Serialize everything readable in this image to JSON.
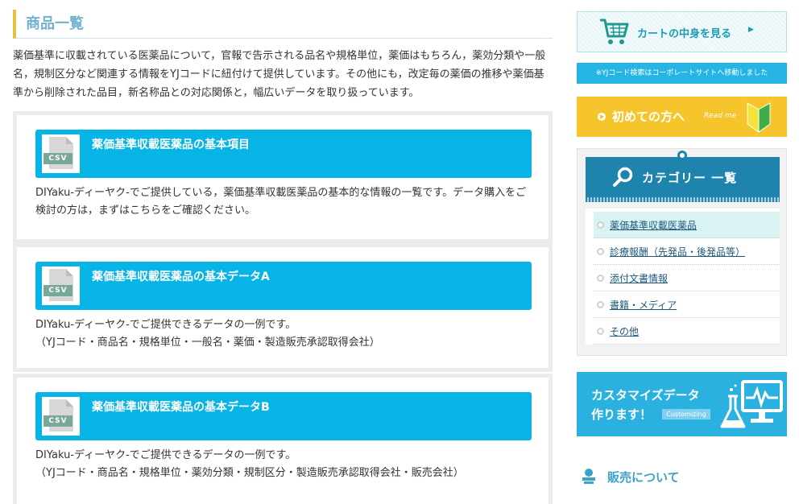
{
  "main": {
    "title": "商品一覧",
    "intro": "薬価基準に収載されている医薬品について，官報で告示される品名や規格単位，薬価はもちろん，薬効分類や一般名，規制区分など関連する情報をYJコードに紐付けて提供しています。その他にも，改定毎の薬価の推移や薬価基準から削除された品目，新名称品との対応関係と，幅広いデータを取り扱っています。",
    "products": [
      {
        "icon_label": "CSV",
        "title": "薬価基準収載医薬品の基本項目",
        "desc": [
          "DIYaku-ディーヤク-でご提供している，薬価基準収載医薬品の基本的な情報の一覧です。データ購入をご検討の方は，まずはこちらをご確認ください。"
        ]
      },
      {
        "icon_label": "CSV",
        "title": "薬価基準収載医薬品の基本データA",
        "desc": [
          "DIYaku-ディーヤク-でご提供できるデータの一例です。",
          "（YJコード・商品名・規格単位・一般名・薬価・製造販売承認取得会社）"
        ]
      },
      {
        "icon_label": "CSV",
        "title": "薬価基準収載医薬品の基本データB",
        "desc": [
          "DIYaku-ディーヤク-でご提供できるデータの一例です。",
          "（YJコード・商品名・規格単位・薬効分類・規制区分・製造販売承認取得会社・販売会社）"
        ]
      }
    ]
  },
  "sidebar": {
    "cart_label": "カートの中身を見る",
    "notice": "※YJコード検索はコーポレートサイトへ移動しました",
    "beginner_label": "初めての方へ",
    "beginner_sub": "Read me",
    "category_title": "カテゴリー 一覧",
    "categories": [
      "薬価基準収載医薬品",
      "診療報酬（先発品・後発品等）",
      "添付文書情報",
      "書籍・メディア",
      "その他"
    ],
    "custom_line1": "カスタマイズデータ",
    "custom_line2": "作ります！",
    "custom_tag": "Customizing",
    "sales_title": "販売について"
  },
  "colors": {
    "accent": "#06b4e6",
    "category_header": "#1f84ad",
    "beginner": "#f6c42b",
    "title_bar": "#e8c33a"
  }
}
